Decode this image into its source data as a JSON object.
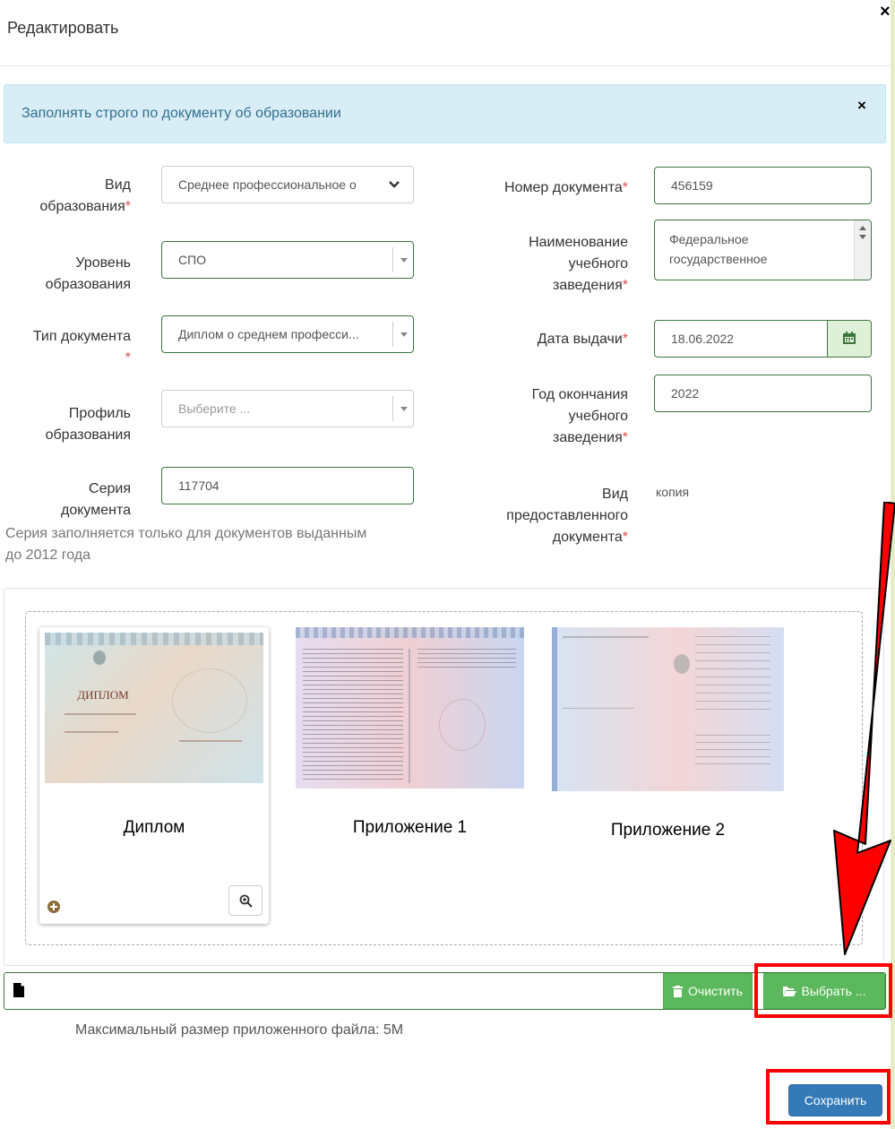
{
  "modal": {
    "title": "Редактировать"
  },
  "alert": {
    "text": "Заполнять строго по документу об образовании"
  },
  "form": {
    "edu_type": {
      "label_1": "Вид",
      "label_2": "образования",
      "req": "*",
      "value": "Среднее профессиональное о"
    },
    "edu_level": {
      "label_1": "Уровень",
      "label_2": "образования",
      "value": "СПО"
    },
    "doc_type": {
      "label": "Тип документа",
      "req": "*",
      "value": "Диплом о среднем професси..."
    },
    "profile": {
      "label_1": "Профиль",
      "label_2": "образования",
      "placeholder": "Выберите ..."
    },
    "series": {
      "label_1": "Серия",
      "label_2": "документа",
      "value": "117704",
      "hint_1": "Серия заполняется только для документов выданным",
      "hint_2": "до 2012 года"
    },
    "doc_number": {
      "label": "Номер документа",
      "req": "*",
      "value": "456159"
    },
    "institution": {
      "label_1": "Наименование",
      "label_2": "учебного",
      "label_3": "заведения",
      "req": "*",
      "value": "Федеральное государственное"
    },
    "issue_date": {
      "label": "Дата выдачи",
      "req": "*",
      "value": "18.06.2022"
    },
    "grad_year": {
      "label_1": "Год окончания",
      "label_2": "учебного",
      "label_3": "заведения",
      "req": "*",
      "value": "2022"
    },
    "provided_type": {
      "label_1": "Вид",
      "label_2": "предоставленного",
      "label_3": "документа",
      "req": "*",
      "value": "копия"
    }
  },
  "uploads": {
    "images": [
      {
        "caption": "Диплом"
      },
      {
        "caption": "Приложение 1"
      },
      {
        "caption": "Приложение 2"
      }
    ],
    "diploma_title": "ДИПЛОМ"
  },
  "filebar": {
    "clear_label": "Очистить",
    "choose_label": "Выбрать ..."
  },
  "max_size": "Максимальный размер приложенного файла: 5M",
  "save_label": "Сохранить",
  "colors": {
    "success": "#3c763d",
    "primary": "#337ab7",
    "green_button": "#5cb85c",
    "alert_bg": "#d9edf7",
    "annotation": "#ff0000"
  },
  "icons": [
    "close-icon",
    "chevron-down-icon",
    "calendar-icon",
    "plus-circle-icon",
    "zoom-in-icon",
    "file-icon",
    "trash-icon",
    "folder-open-icon",
    "arrow-annotation"
  ]
}
